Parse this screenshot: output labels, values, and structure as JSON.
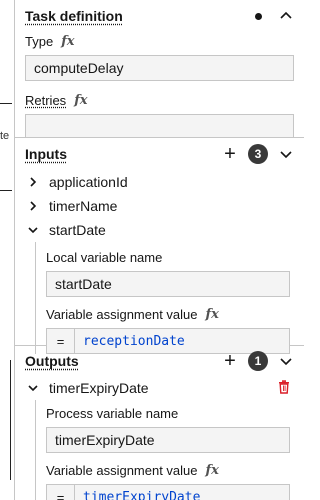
{
  "canvas": {
    "label": "te"
  },
  "task_definition": {
    "title": "Task definition",
    "type_label": "Type",
    "type_value": "computeDelay",
    "retries_label": "Retries",
    "retries_value": ""
  },
  "inputs": {
    "title": "Inputs",
    "count": "3",
    "items": [
      {
        "name": "applicationId"
      },
      {
        "name": "timerName"
      },
      {
        "name": "startDate"
      }
    ],
    "expanded": {
      "local_var_label": "Local variable name",
      "local_var_value": "startDate",
      "assign_label": "Variable assignment value",
      "assign_eq": "=",
      "assign_value": "receptionDate"
    }
  },
  "outputs": {
    "title": "Outputs",
    "count": "1",
    "item": {
      "name": "timerExpiryDate"
    },
    "expanded": {
      "process_var_label": "Process variable name",
      "process_var_value": "timerExpiryDate",
      "assign_label": "Variable assignment value",
      "assign_eq": "=",
      "assign_value": "timerExpiryDate"
    }
  },
  "colors": {
    "accent_link": "#0043ce",
    "danger": "#da1e28",
    "badge_bg": "#393939"
  }
}
